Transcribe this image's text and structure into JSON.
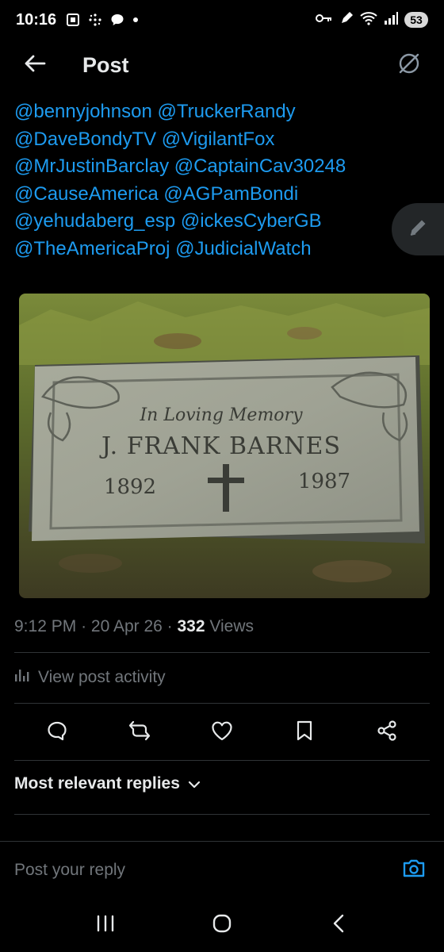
{
  "status_bar": {
    "time": "10:16",
    "battery": "53",
    "left_icons": [
      "screenshot-icon",
      "dots-grid-icon",
      "chat-bubble-icon",
      "dot-icon"
    ],
    "right_icons": [
      "key-icon",
      "pen-icon",
      "wifi-icon",
      "signal-icon"
    ]
  },
  "header": {
    "title": "Post",
    "back_icon": "arrow-left-icon",
    "grok_icon": "grok-icon"
  },
  "post": {
    "mention_lines": [
      "@bennyjohnson @TruckerRandy",
      "@DaveBondyTV @VigilantFox",
      "@MrJustinBarclay @CaptainCav30248",
      "@CauseAmerica @AGPamBondi",
      "@yehudaberg_esp @ickesCyberGB",
      "@TheAmericaProj @JudicialWatch"
    ],
    "image": {
      "inscription_header": "In Loving Memory",
      "name": "J. FRANK BARNES",
      "birth_year": "1892",
      "death_year": "1987"
    },
    "meta": {
      "time": "9:12 PM",
      "separator": "·",
      "date": "20 Apr 26",
      "views_count": "332",
      "views_label": "Views"
    },
    "activity_label": "View post activity"
  },
  "actions": [
    "reply-icon",
    "repost-icon",
    "like-icon",
    "bookmark-icon",
    "share-icon"
  ],
  "replies": {
    "sort_label": "Most relevant replies"
  },
  "reply_bar": {
    "placeholder": "Post your reply"
  },
  "colors": {
    "accent": "#1d9bf0",
    "background": "#000000",
    "muted": "#71767b",
    "divider": "#2f3336"
  }
}
